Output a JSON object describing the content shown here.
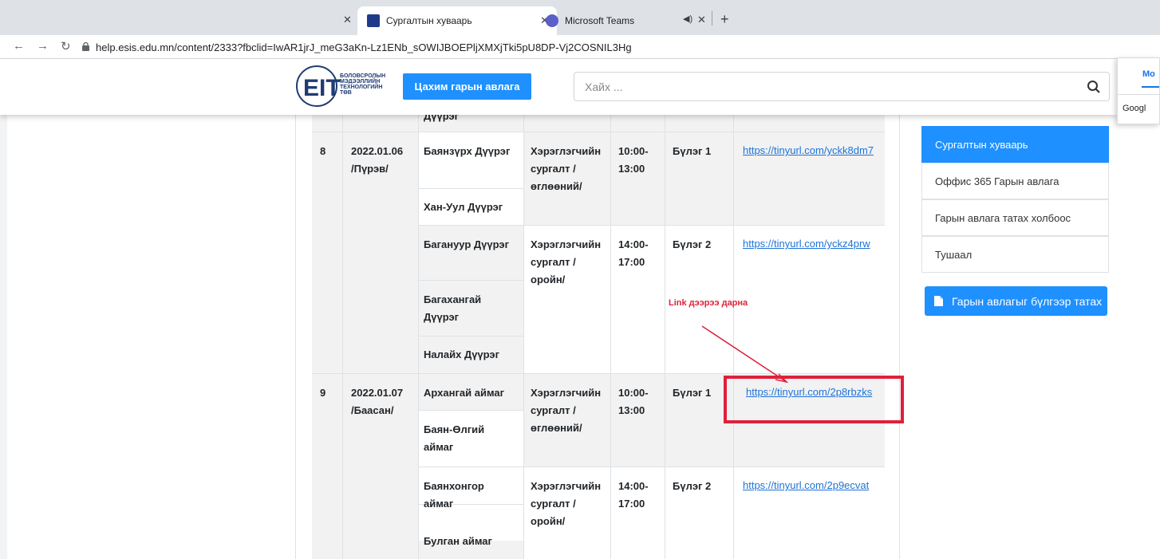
{
  "browser": {
    "tabs": [
      {
        "label": "Сургалтын хуваарь",
        "favicon_color": "#1e3a8a"
      },
      {
        "label": "Microsoft Teams",
        "favicon_color": "#5b5fc7"
      }
    ],
    "address": "help.esis.edu.mn/content/2333?fbclid=IwAR1jrJ_meG3aKn-Lz1ENb_sOWIJBOEPljXMXjTki5pU8DP-Vj2COSNIL3Hg"
  },
  "header": {
    "logo_text": [
      "БОЛОВСРОЛЫН",
      "МЭДЭЭЛЛИЙН",
      "ТЕХНОЛОГИЙН",
      "ТӨВ"
    ],
    "guide_button": "Цахим гарын авлага",
    "search_placeholder": "Хайх ..."
  },
  "popup": {
    "top": "Mo",
    "bottom": "Googl"
  },
  "table": {
    "partial_top": "Дүүрэг",
    "rows": [
      {
        "no": "8",
        "date": "2022.01.06",
        "day": "/Пүрэв/",
        "groups": [
          {
            "districts": [
              "Баянзүрх Дүүрэг",
              "Хан-Уул Дүүрэг"
            ],
            "type": "Хэрэглэгчийн сургалт / өглөөний/",
            "time": "10:00-13:00",
            "group": "Бүлэг 1",
            "link": "https://tinyurl.com/yckk8dm7"
          },
          {
            "districts": [
              "Багануур Дүүрэг",
              "Багахангай Дүүрэг",
              "Налайх Дүүрэг"
            ],
            "type": "Хэрэглэгчийн сургалт / оройн/",
            "time": "14:00-17:00",
            "group": "Бүлэг 2",
            "link": "https://tinyurl.com/yckz4prw"
          }
        ]
      },
      {
        "no": "9",
        "date": "2022.01.07",
        "day": "/Баасан/",
        "groups": [
          {
            "districts": [
              "Архангай аймаг",
              "Баян-Өлгий аймаг"
            ],
            "type": "Хэрэглэгчийн сургалт / өглөөний/",
            "time": "10:00-13:00",
            "group": "Бүлэг 1",
            "link": "https://tinyurl.com/2p8rbzks"
          },
          {
            "districts": [
              "Баянхонгор аймаг",
              "Булган аймаг"
            ],
            "type": "Хэрэглэгчийн сургалт / оройн/",
            "time": "14:00-17:00",
            "group": "Бүлэг 2",
            "link": "https://tinyurl.com/2p9ecvat"
          }
        ]
      }
    ]
  },
  "sidebar": {
    "items": [
      "Сургалтын хуваарь",
      "Оффис 365 Гарын авлага",
      "Гарын авлага татах холбоос",
      "Тушаал"
    ],
    "download_button": "Гарын авлагыг бүлгээр татах"
  },
  "annotation": {
    "text": "Link дээрээ дарна",
    "color": "#e0203a"
  },
  "colors": {
    "accent": "#1e90ff",
    "link": "#1e73d8",
    "stripe": "#f2f2f2"
  }
}
